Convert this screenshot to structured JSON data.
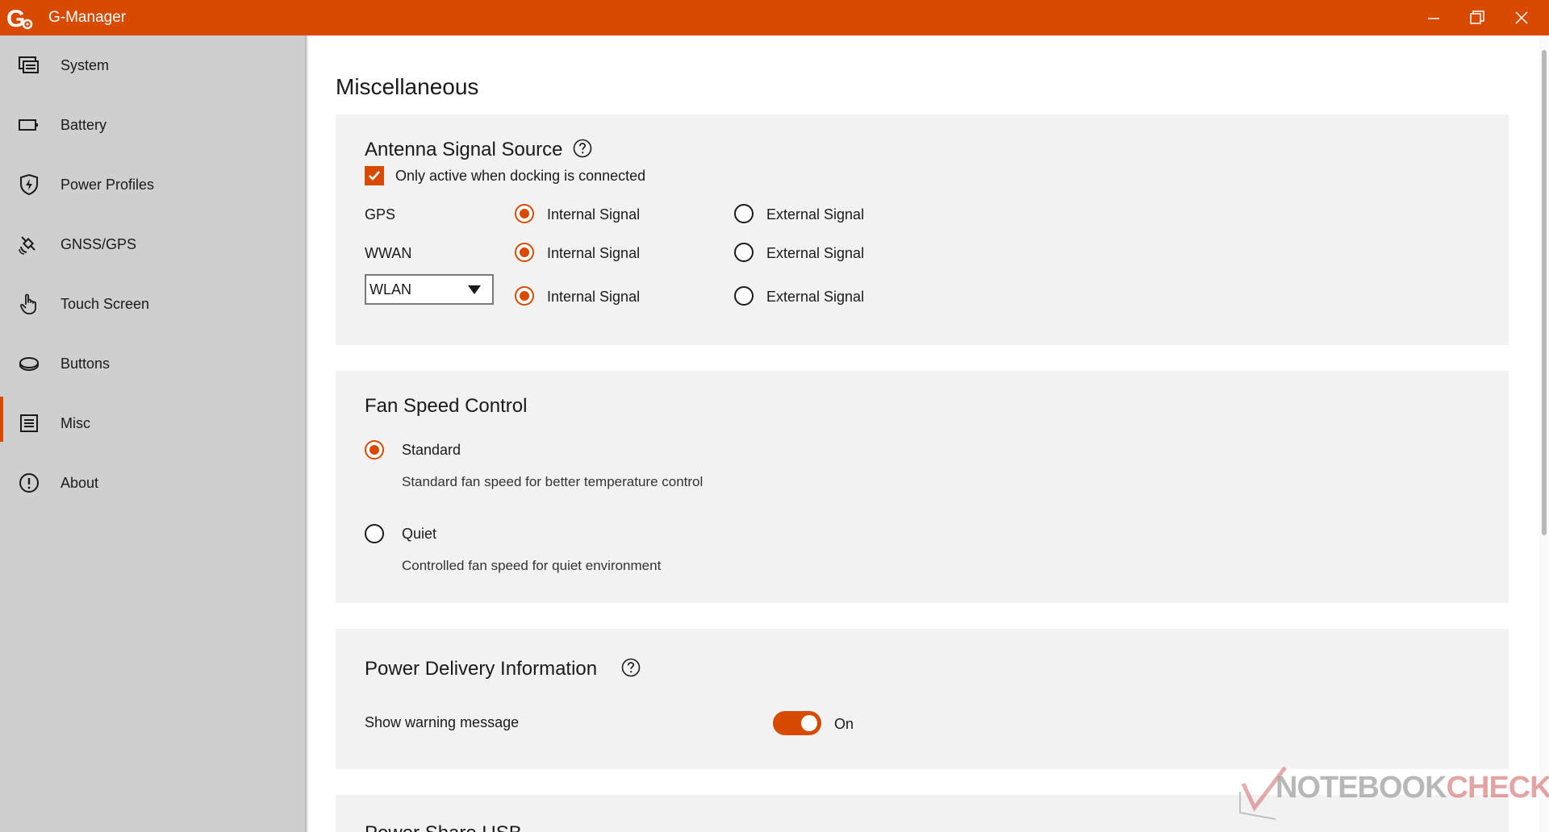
{
  "app": {
    "title": "G-Manager",
    "accent_color": "#d84a00",
    "window_controls": [
      "minimize-icon",
      "restore-icon",
      "close-icon"
    ]
  },
  "sidebar": {
    "items": [
      {
        "label": "System",
        "icon": "system-icon",
        "active": false
      },
      {
        "label": "Battery",
        "icon": "battery-icon",
        "active": false
      },
      {
        "label": "Power Profiles",
        "icon": "power-shield-icon",
        "active": false
      },
      {
        "label": "GNSS/GPS",
        "icon": "satellite-icon",
        "active": false
      },
      {
        "label": "Touch Screen",
        "icon": "touch-hand-icon",
        "active": false
      },
      {
        "label": "Buttons",
        "icon": "buttons-icon",
        "active": false
      },
      {
        "label": "Misc",
        "icon": "list-icon",
        "active": true
      },
      {
        "label": "About",
        "icon": "info-icon",
        "active": false
      }
    ]
  },
  "main": {
    "page_title": "Miscellaneous",
    "antenna": {
      "title": "Antenna Signal Source",
      "docking_checkbox_label": "Only active when docking is connected",
      "docking_checked": true,
      "rows": [
        {
          "label": "GPS",
          "internal_label": "Internal Signal",
          "external_label": "External Signal",
          "selected": "internal"
        },
        {
          "label": "WWAN",
          "internal_label": "Internal Signal",
          "external_label": "External Signal",
          "selected": "internal"
        },
        {
          "label": "WLAN",
          "internal_label": "Internal Signal",
          "external_label": "External Signal",
          "selected": "internal"
        }
      ]
    },
    "fan": {
      "title": "Fan Speed Control",
      "options": [
        {
          "label": "Standard",
          "description": "Standard fan speed for better temperature control",
          "selected": true
        },
        {
          "label": "Quiet",
          "description": "Controlled fan speed for quiet environment",
          "selected": false
        }
      ]
    },
    "power_delivery": {
      "title": "Power Delivery Information",
      "warning_label": "Show warning message",
      "toggle_state": "On",
      "toggle_on": true
    },
    "next_section_title": "Power Share USB"
  },
  "watermark": {
    "text_prefix": "NOTEBOOK",
    "text_suffix": "CHECK"
  }
}
